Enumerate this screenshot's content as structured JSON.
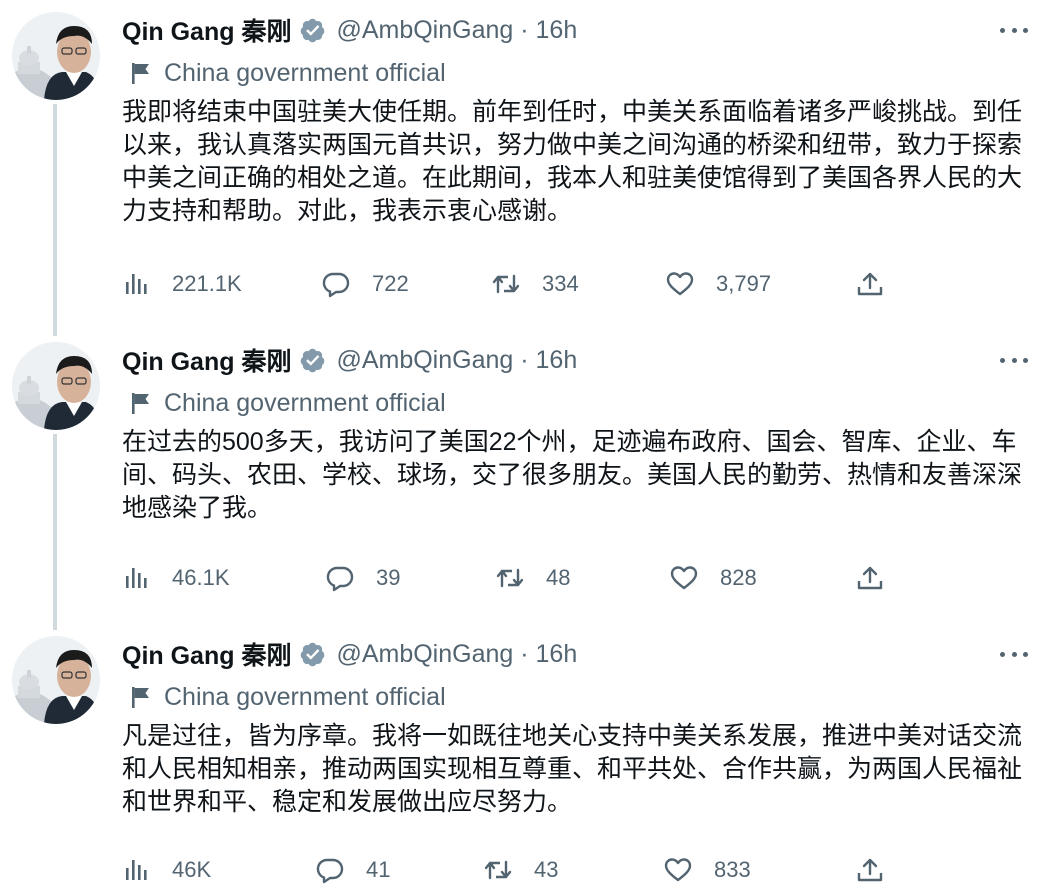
{
  "author": {
    "name": "Qin Gang 秦刚",
    "handle": "@AmbQinGang",
    "time": "16h",
    "label": "China government official"
  },
  "colors": {
    "text": "#0f1419",
    "muted": "#536471",
    "verified_badge": "#829aab",
    "thread_line": "#cfd9de"
  },
  "icons": {
    "verified": "verified-badge-icon",
    "label": "flag-icon",
    "more": "more-options-icon",
    "views": "views-chart-icon",
    "reply": "reply-bubble-icon",
    "retweet": "retweet-icon",
    "like": "heart-icon",
    "share": "share-upload-icon"
  },
  "tweets": [
    {
      "text": "我即将结束中国驻美大使任期。前年到任时，中美关系面临着诸多严峻挑战。到任以来，我认真落实两国元首共识，努力做中美之间沟通的桥梁和纽带，致力于探索中美之间正确的相处之道。在此期间，我本人和驻美使馆得到了美国各界人民的大力支持和帮助。对此，我表示衷心感谢。",
      "views": "221.1K",
      "replies": "722",
      "retweets": "334",
      "likes": "3,797"
    },
    {
      "text": "在过去的500多天，我访问了美国22个州，足迹遍布政府、国会、智库、企业、车间、码头、农田、学校、球场，交了很多朋友。美国人民的勤劳、热情和友善深深地感染了我。",
      "views": "46.1K",
      "replies": "39",
      "retweets": "48",
      "likes": "828"
    },
    {
      "text": "凡是过往，皆为序章。我将一如既往地关心支持中美关系发展，推进中美对话交流和人民相知相亲，推动两国实现相互尊重、和平共处、合作共赢，为两国人民福祉和世界和平、稳定和发展做出应尽努力。",
      "views": "46K",
      "replies": "41",
      "retweets": "43",
      "likes": "833"
    }
  ]
}
